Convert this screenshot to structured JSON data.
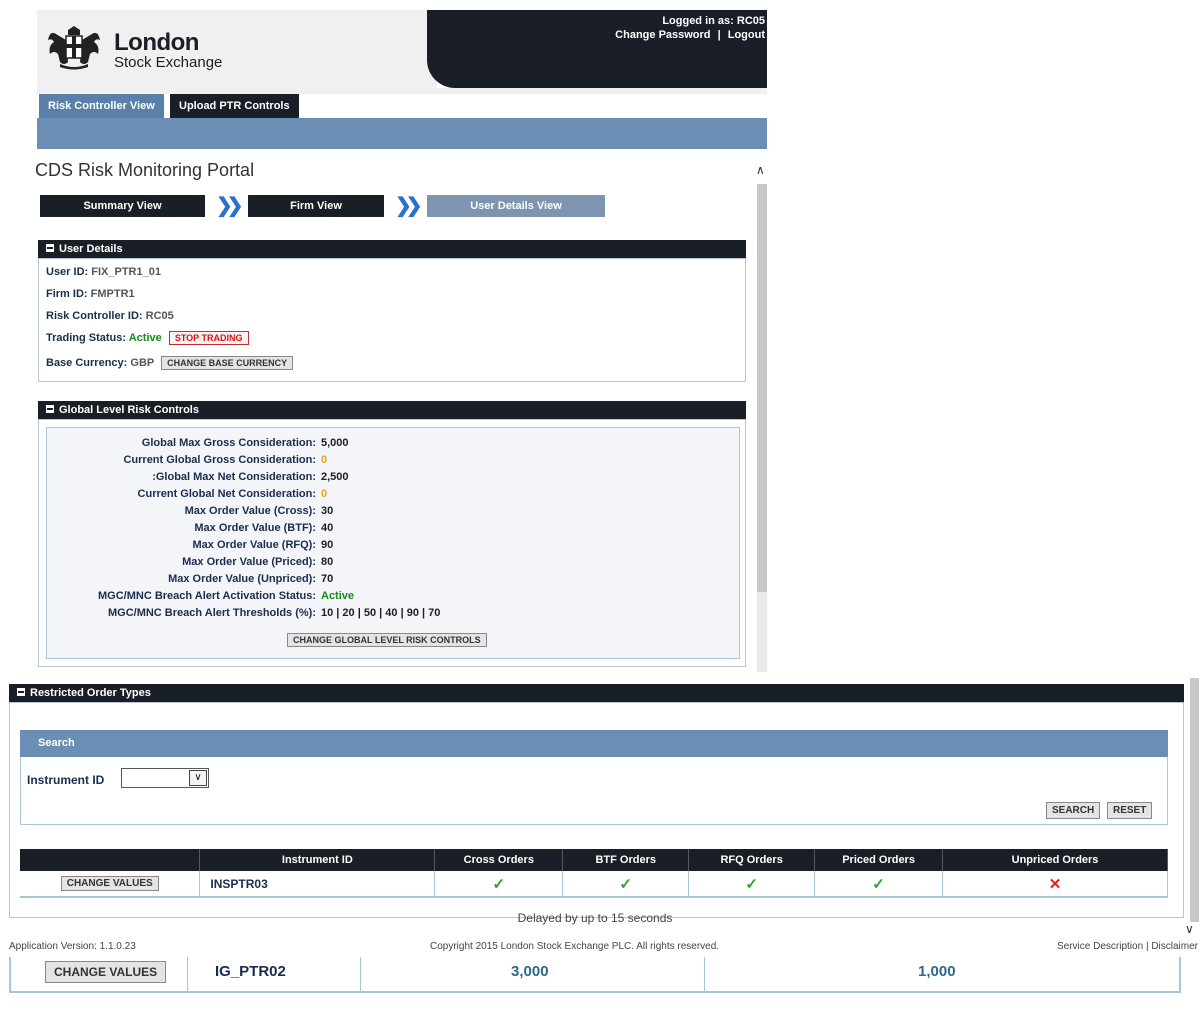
{
  "header": {
    "logo_line1": "London",
    "logo_line2": "Stock Exchange",
    "logged_in": "Logged in as: RC05",
    "change_password": "Change Password",
    "separator": "|",
    "logout": "Logout"
  },
  "tabs": [
    {
      "label": "Risk Controller View",
      "active": true
    },
    {
      "label": "Upload PTR Controls",
      "active": false
    }
  ],
  "portal_title": "CDS Risk Monitoring Portal",
  "steps": [
    {
      "label": "Summary View"
    },
    {
      "label": "Firm View"
    },
    {
      "label": "User Details View"
    }
  ],
  "user_details": {
    "title": "User Details",
    "user_id_label": "User ID:",
    "user_id": "FIX_PTR1_01",
    "firm_id_label": "Firm ID:",
    "firm_id": "FMPTR1",
    "risk_controller_label": "Risk Controller ID:",
    "risk_controller": "RC05",
    "trading_status_label": "Trading Status:",
    "trading_status": "Active",
    "stop_trading": "STOP TRADING",
    "base_currency_label": "Base Currency:",
    "base_currency": "GBP",
    "change_base_currency": "CHANGE BASE CURRENCY"
  },
  "global_controls": {
    "title": "Global Level Risk Controls",
    "rows": [
      {
        "label": "Global Max Gross Consideration:",
        "value": "5,000",
        "color": "dark"
      },
      {
        "label": "Current Global Gross Consideration:",
        "value": "0",
        "color": "orange"
      },
      {
        "label": ":Global Max Net Consideration:",
        "value": "2,500",
        "color": "dark"
      },
      {
        "label": "Current Global Net Consideration:",
        "value": "0",
        "color": "orange"
      },
      {
        "label": "Max Order Value (Cross):",
        "value": "30",
        "color": "dark"
      },
      {
        "label": "Max Order Value (BTF):",
        "value": "40",
        "color": "dark"
      },
      {
        "label": "Max Order Value (RFQ):",
        "value": "90",
        "color": "dark"
      },
      {
        "label": "Max Order Value (Priced):",
        "value": "80",
        "color": "dark"
      },
      {
        "label": "Max Order Value (Unpriced):",
        "value": "70",
        "color": "dark"
      },
      {
        "label": "MGC/MNC Breach Alert Activation Status:",
        "value": "Active",
        "color": "green"
      },
      {
        "label": "MGC/MNC Breach Alert Thresholds (%):",
        "value": "10 | 20 | 50 | 40 | 90 | 70",
        "color": "dark"
      }
    ],
    "change_button": "CHANGE GLOBAL LEVEL RISK CONTROLS"
  },
  "restricted": {
    "title": "Restricted Order Types",
    "search_title": "Search",
    "instrument_label": "Instrument ID",
    "instrument_value": "",
    "search_button": "SEARCH",
    "reset_button": "RESET",
    "columns": [
      "",
      "Instrument ID",
      "Cross Orders",
      "BTF Orders",
      "RFQ Orders",
      "Priced Orders",
      "Unpriced Orders"
    ],
    "rows": [
      {
        "button": "CHANGE VALUES",
        "instrument": "INSPTR03",
        "cross": "✓",
        "btf": "✓",
        "rfq": "✓",
        "priced": "✓",
        "unpriced": "✕"
      }
    ]
  },
  "footer": {
    "delayed": "Delayed by up to 15 seconds",
    "app_version": "Application Version: 1.1.0.23",
    "copyright": "Copyright 2015 London Stock Exchange PLC. All rights reserved.",
    "service_description": "Service Description",
    "link_sep": "|",
    "disclaimer": "Disclaimer"
  },
  "bottom_row": {
    "button": "CHANGE VALUES",
    "instrument": "IG_PTR02",
    "value1": "3,000",
    "value2": "1,000"
  },
  "colors": {
    "dark": "#1a1e26",
    "steel_blue": "#6b8eb5",
    "active_green": "#1a8a1a",
    "check_green": "#2fa02f",
    "cross_red": "#e02020",
    "orange": "#f0a020"
  }
}
